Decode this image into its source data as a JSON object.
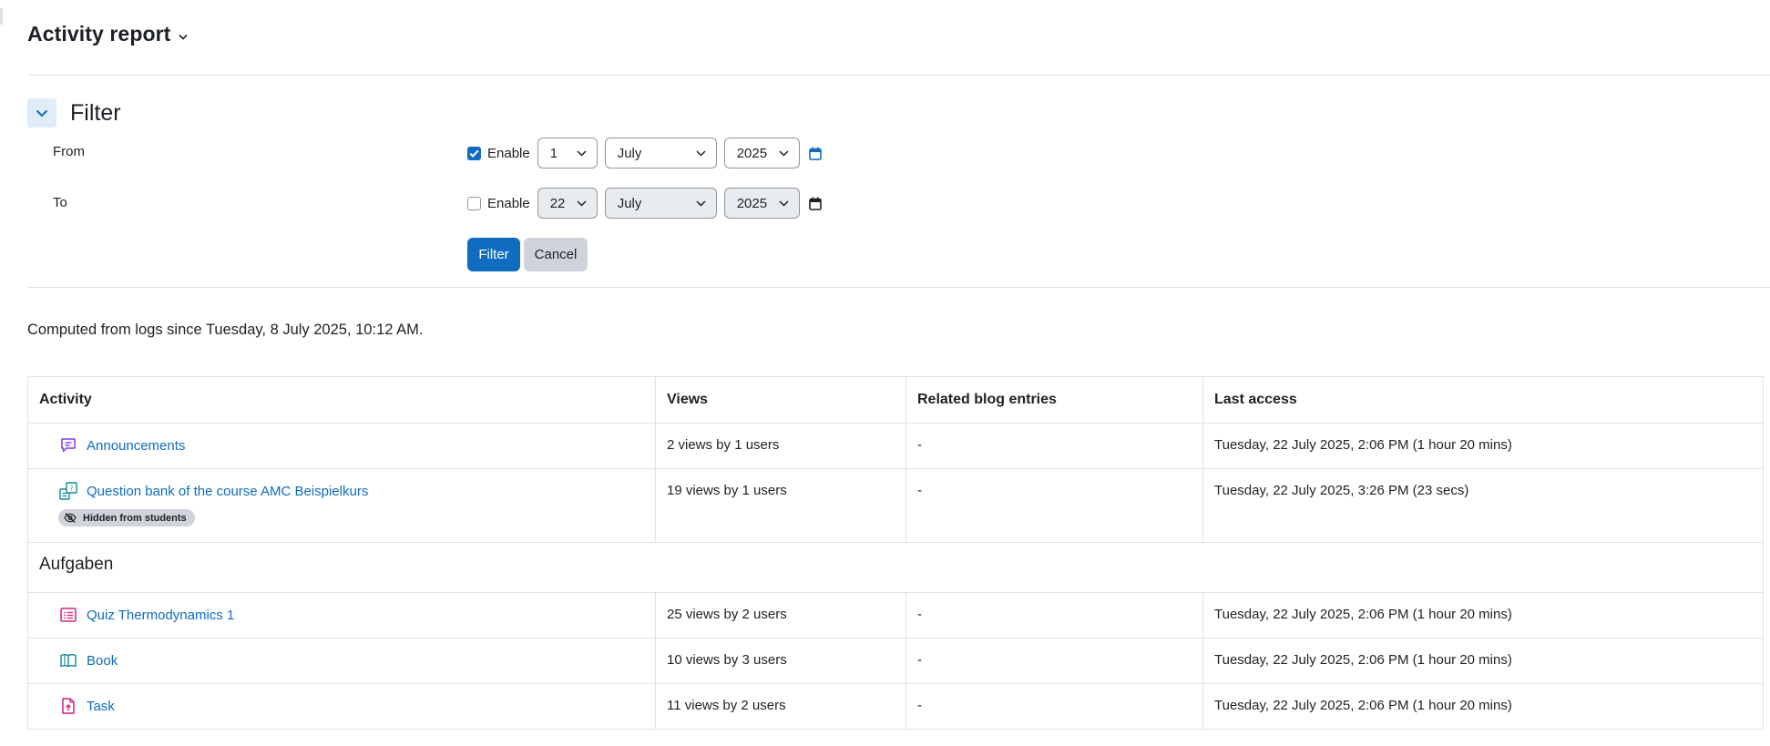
{
  "page_title": "Activity report",
  "filter": {
    "heading": "Filter",
    "from": {
      "label": "From",
      "enable_label": "Enable",
      "enabled": true,
      "day": "1",
      "month": "July",
      "year": "2025"
    },
    "to": {
      "label": "To",
      "enable_label": "Enable",
      "enabled": false,
      "day": "22",
      "month": "July",
      "year": "2025"
    },
    "filter_button": "Filter",
    "cancel_button": "Cancel"
  },
  "computed_text": "Computed from logs since Tuesday, 8 July 2025, 10:12 AM.",
  "table": {
    "headers": [
      "Activity",
      "Views",
      "Related blog entries",
      "Last access"
    ],
    "rows": [
      {
        "icon": "forum-icon",
        "name": "Announcements",
        "views": "2 views by 1 users",
        "blog": "-",
        "last_access": "Tuesday, 22 July 2025, 2:06 PM (1 hour 20 mins)"
      },
      {
        "icon": "question-bank-icon",
        "name": "Question bank of the course AMC Beispielkurs",
        "badge": "Hidden from students",
        "views": "19 views by 1 users",
        "blog": "-",
        "last_access": "Tuesday, 22 July 2025, 3:26 PM (23 secs)"
      }
    ],
    "section": "Aufgaben",
    "section_rows": [
      {
        "icon": "quiz-icon",
        "name": "Quiz Thermodynamics 1",
        "views": "25 views by 2 users",
        "blog": "-",
        "last_access": "Tuesday, 22 July 2025, 2:06 PM (1 hour 20 mins)"
      },
      {
        "icon": "book-icon",
        "name": "Book",
        "views": "10 views by 3 users",
        "blog": "-",
        "last_access": "Tuesday, 22 July 2025, 2:06 PM (1 hour 20 mins)"
      },
      {
        "icon": "assignment-icon",
        "name": "Task",
        "views": "11 views by 2 users",
        "blog": "-",
        "last_access": "Tuesday, 22 July 2025, 2:06 PM (1 hour 20 mins)"
      }
    ]
  },
  "colors": {
    "primary": "#0f6cbf",
    "link": "#0f6cbf",
    "collaboration_icon": "#7f3fe2",
    "content_icon": "#0e8a95",
    "assessment_icon": "#d4207a",
    "border": "#dee2e6"
  }
}
